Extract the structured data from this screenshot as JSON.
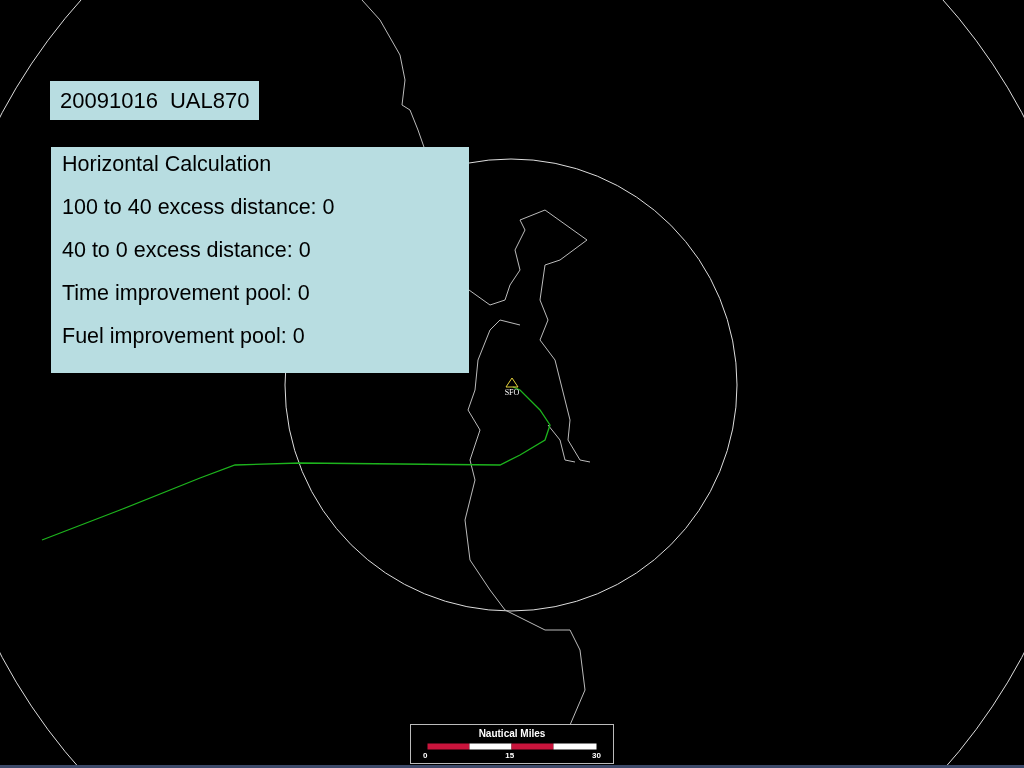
{
  "flight_label": {
    "date": "20091016",
    "flight": "UAL870"
  },
  "calculation_panel": {
    "title": "Horizontal Calculation",
    "lines": [
      "100 to 40 excess distance: 0",
      "40 to 0 excess distance: 0",
      "Time improvement pool: 0",
      "Fuel improvement pool: 0"
    ]
  },
  "airport": {
    "code": "SFO"
  },
  "scale_bar": {
    "title": "Nautical Miles",
    "ticks": [
      "0",
      "15",
      "30"
    ]
  }
}
